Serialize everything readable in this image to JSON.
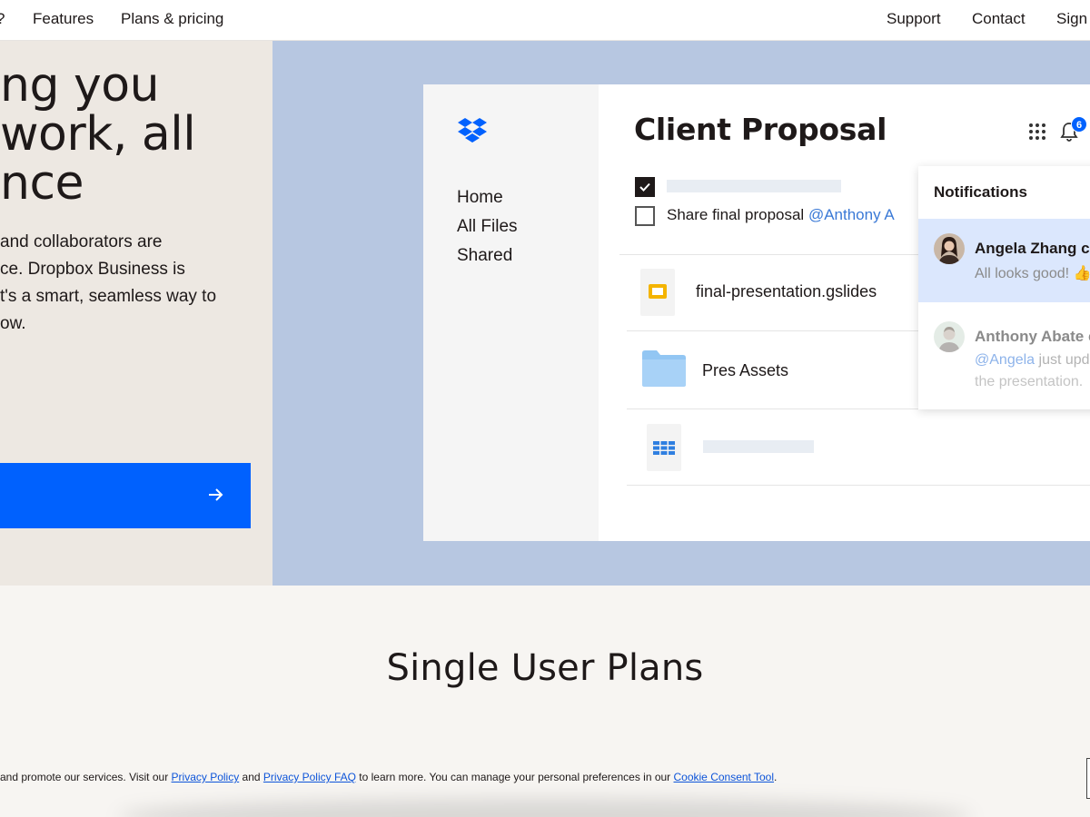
{
  "nav": {
    "left_fragment": "?",
    "features": "Features",
    "pricing": "Plans & pricing",
    "support": "Support",
    "contact": "Contact",
    "signin": "Sign"
  },
  "hero": {
    "headline": [
      "ng you",
      "work, all",
      "nce"
    ],
    "subtext": [
      "and collaborators are",
      "ce. Dropbox Business is",
      "t's a smart, seamless way to",
      "ow."
    ]
  },
  "mock": {
    "title": "Client Proposal",
    "sidebar": [
      "Home",
      "All Files",
      "Shared"
    ],
    "task": {
      "text": "Share final proposal ",
      "mention": "@Anthony A"
    },
    "files": [
      {
        "name": "final-presentation.gslides",
        "icon": "slides-icon"
      },
      {
        "name": "Pres Assets",
        "icon": "folder-icon"
      },
      {
        "name": "",
        "icon": "sheet-icon"
      }
    ],
    "badge_count": "6",
    "notifications": {
      "title": "Notifications",
      "items": [
        {
          "name": "Angela Zhang c",
          "message": "All looks good! 👍"
        },
        {
          "name": "Anthony Abate c",
          "mention": "@Angela",
          "message_rest": " just upd",
          "message_line2": "the presentation."
        }
      ]
    }
  },
  "plans": {
    "title": "Single User Plans"
  },
  "cookie": {
    "prefix": "and promote our services. Visit our ",
    "privacy_policy": "Privacy Policy",
    "and": " and ",
    "privacy_faq": "Privacy Policy FAQ",
    "mid": " to learn more. You can manage your personal preferences in our ",
    "consent_tool": "Cookie Consent Tool",
    "suffix": "."
  },
  "colors": {
    "accent": "#0061fe",
    "hero_right_bg": "#b7c7e1",
    "hero_left_bg": "#ede8e2",
    "highlight": "#dbe7fd"
  }
}
